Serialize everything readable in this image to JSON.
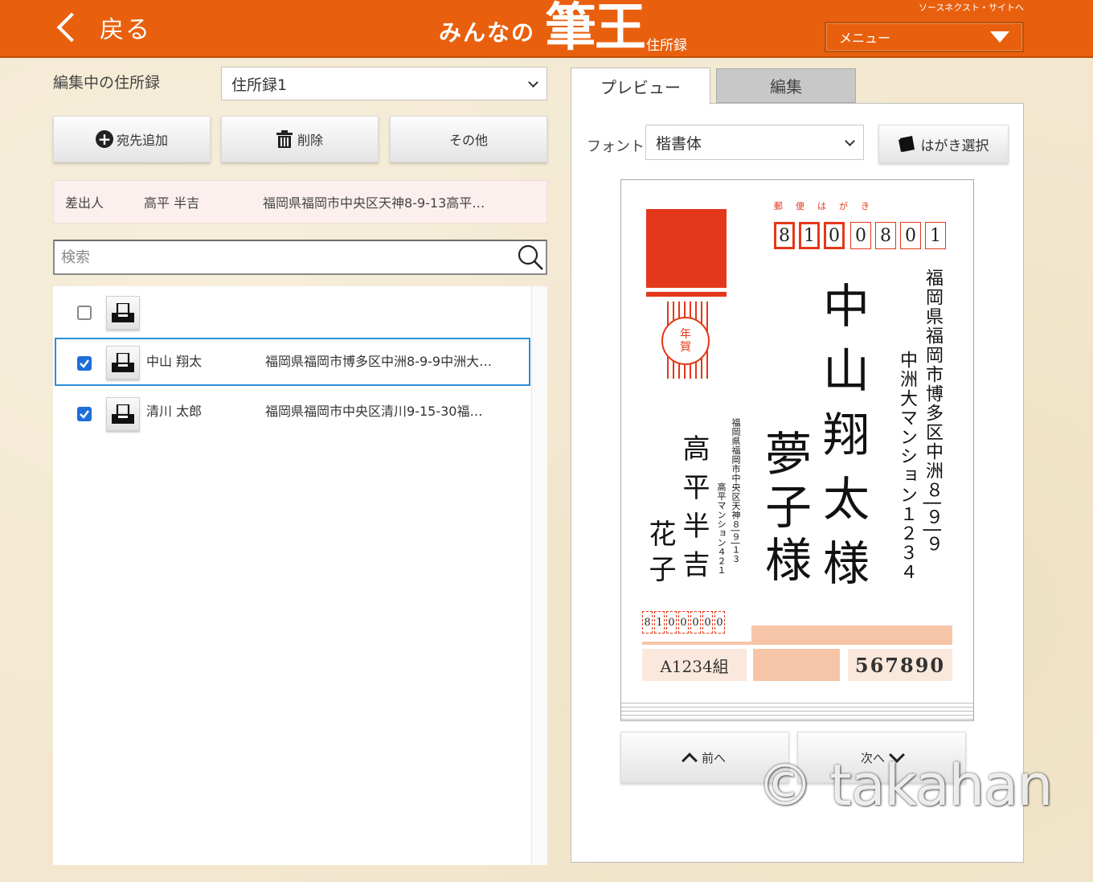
{
  "header": {
    "back_label": "戻る",
    "logo_minna": "みんなの",
    "logo_main": "筆王",
    "logo_sub": "住所録",
    "source_link": "ソースネクスト・サイトへ",
    "menu_label": "メニュー",
    "background": "#e8600e"
  },
  "left": {
    "editing_label": "編集中の住所録",
    "book_value": "住所録1",
    "buttons": {
      "add": "宛先追加",
      "delete": "削除",
      "other": "その他"
    },
    "sender": {
      "label": "差出人",
      "name": "高平 半吉",
      "address": "福岡県福岡市中央区天神8-9-13高平…"
    },
    "search_placeholder": "検索",
    "rows": [
      {
        "checked": false,
        "name": "",
        "address": ""
      },
      {
        "checked": true,
        "name": "中山 翔太",
        "address": "福岡県福岡市博多区中洲8-9-9中洲大…"
      },
      {
        "checked": true,
        "name": "清川 太郎",
        "address": "福岡県福岡市中央区清川9-15-30福…"
      }
    ]
  },
  "right": {
    "tabs": {
      "preview": "プレビュー",
      "edit": "編集"
    },
    "font_label": "フォント",
    "font_value": "楷書体",
    "hagaki_button": "はがき選択",
    "card": {
      "yubin_hagaki": "郵便はがき",
      "stamp_text_1": "年",
      "stamp_text_2": "賀",
      "zip": [
        "8",
        "1",
        "0",
        "0",
        "8",
        "0",
        "1"
      ],
      "recipient_address_1": "福岡県福岡市博多区中洲８|９|９",
      "recipient_address_2": "中洲大マンション１２３４",
      "recipient_name_1": "中山翔太様",
      "recipient_name_2": "夢子様",
      "sender_address_1": "福岡県福岡市中央区天神８|９|１３",
      "sender_address_2": "高平マンション４２１",
      "sender_name_1": "高平半吉",
      "sender_name_2": "花子",
      "sender_zip": [
        "8",
        "1",
        "0",
        "0",
        "0",
        "0",
        "0"
      ],
      "lot_group": "A1234組",
      "lot_number": "567890",
      "stamp_color": "#e4381a",
      "lottery_color": "#f6c4a6"
    },
    "nav": {
      "prev": "前へ",
      "next": "次へ"
    }
  },
  "watermark": "© takahan"
}
